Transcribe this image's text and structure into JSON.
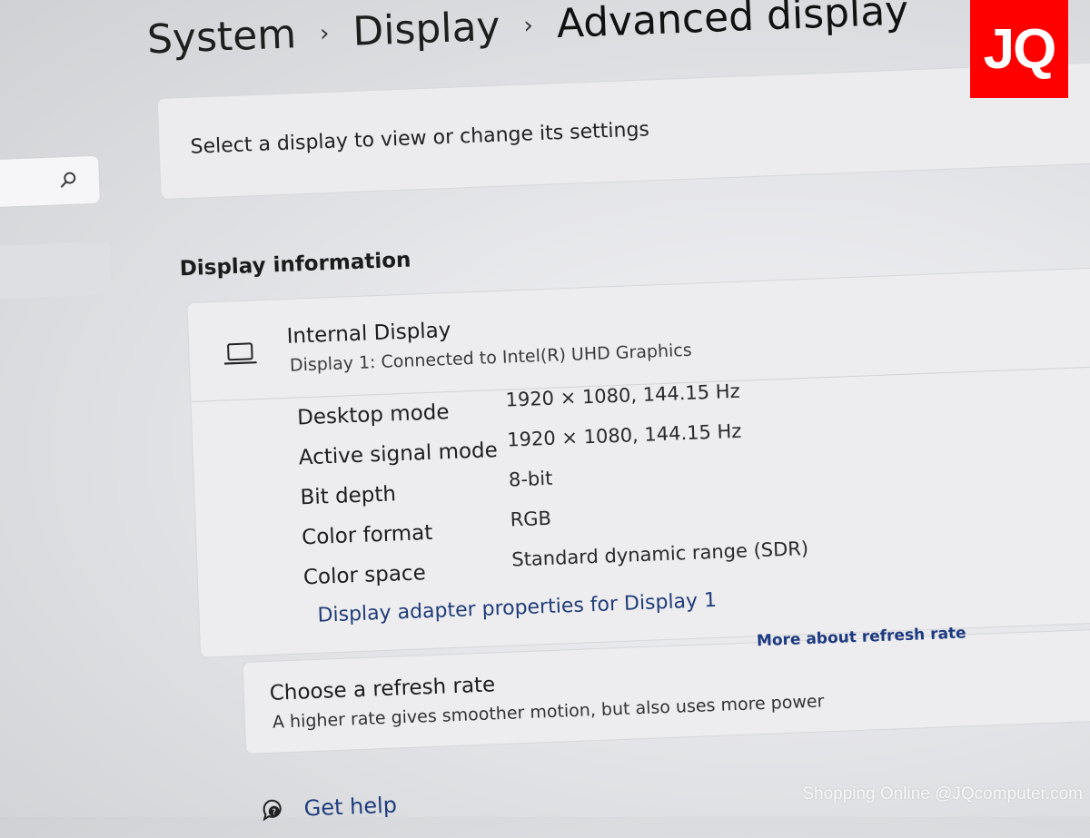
{
  "breadcrumb": {
    "items": [
      "System",
      "Display",
      "Advanced display"
    ],
    "separator": "›"
  },
  "search": {
    "icon": "search-icon"
  },
  "select_card": {
    "label": "Select a display to view or change its settings"
  },
  "display_info": {
    "section_title": "Display information",
    "device": {
      "icon": "laptop-icon",
      "name": "Internal Display",
      "subtitle": "Display 1: Connected to Intel(R) UHD Graphics"
    },
    "rows": [
      {
        "key": "Desktop mode",
        "value": "1920 × 1080, 144.15 Hz"
      },
      {
        "key": "Active signal mode",
        "value": "1920 × 1080, 144.15 Hz"
      },
      {
        "key": "Bit depth",
        "value": "8-bit"
      },
      {
        "key": "Color format",
        "value": "RGB"
      },
      {
        "key": "Color space",
        "value": "Standard dynamic range (SDR)"
      }
    ],
    "adapter_link": "Display adapter properties for Display 1"
  },
  "refresh_rate": {
    "title": "Choose a refresh rate",
    "description": "A higher rate gives smoother motion, but also uses more power",
    "link": "More about refresh rate"
  },
  "help": {
    "label": "Get help",
    "icon": "help-icon"
  },
  "logo": {
    "text": "JQ",
    "color": "#ff0000"
  },
  "watermark": "Shopping Online @JQcomputer.com"
}
